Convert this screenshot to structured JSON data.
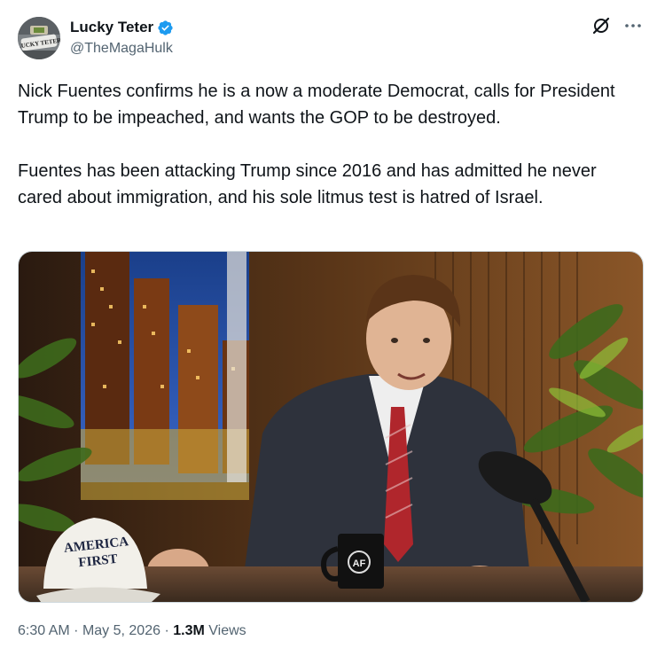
{
  "author": {
    "display_name": "Lucky Teter",
    "handle": "@TheMagaHulk",
    "avatar_text": "LUCKY TETER"
  },
  "tweet": {
    "paragraph_1": "Nick Fuentes confirms he is a now a moderate Democrat, calls for President Trump to be impeached, and wants the GOP to be destroyed.",
    "paragraph_2": "Fuentes has been attacking Trump since 2016 and has admitted he never cared about immigration, and his sole litmus test is hatred of Israel."
  },
  "media": {
    "hat_text_line1": "AMERICA",
    "hat_text_line2": "FIRST",
    "mug_logo": "AF"
  },
  "meta": {
    "time": "6:30 AM",
    "separator_1": "·",
    "date": "May 5, 2026",
    "separator_2": "·",
    "views_count": "1.3M",
    "views_label": "Views"
  },
  "colors": {
    "verified": "#1d9bf0",
    "secondary_text": "#536471",
    "primary_text": "#0f1419"
  },
  "icons": [
    "verified-badge-icon",
    "grok-icon",
    "more-options-icon"
  ]
}
